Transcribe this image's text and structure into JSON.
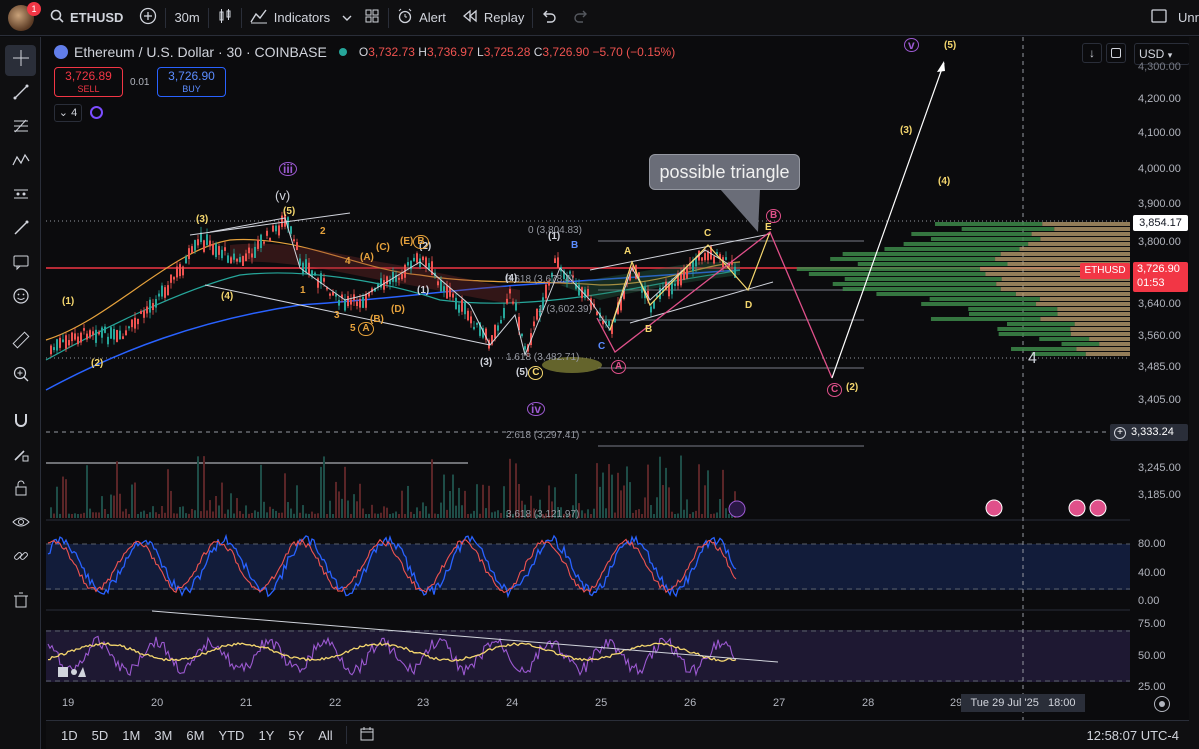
{
  "topbar": {
    "avatar_badge": "1",
    "symbol": "ETHUSD",
    "interval": "30m",
    "indicators": "Indicators",
    "alert": "Alert",
    "replay": "Replay",
    "right_text": "Unr"
  },
  "legend": {
    "title": "Ethereum / U.S. Dollar · 30 · COINBASE",
    "o_label": "O",
    "o": "3,732.73",
    "h_label": "H",
    "h": "3,736.97",
    "l_label": "L",
    "l": "3,725.28",
    "c_label": "C",
    "c": "3,726.90",
    "change": "−5.70 (−0.15%)",
    "sell_price": "3,726.89",
    "sell_label": "SELL",
    "spread": "0.01",
    "buy_price": "3,726.90",
    "buy_label": "BUY",
    "indicator_count": "4"
  },
  "currency": "USD",
  "price_axis": [
    "4,200.00",
    "4,100.00",
    "4,000.00",
    "3,900.00",
    "3,800.00",
    "3,640.00",
    "3,560.00",
    "3,485.00",
    "3,405.00",
    "3,245.00",
    "3,185.00"
  ],
  "price_axis_top_clip": "4,300.00",
  "price_badges": {
    "level": "3,854.17",
    "last_symbol": "ETHUSD",
    "last_price": "3,726.90",
    "countdown": "01:53",
    "crosshair": "3,333.24"
  },
  "osc_axis": [
    "80.00",
    "40.00",
    "0.00"
  ],
  "rsi_axis": [
    "75.00",
    "50.00",
    "25.00"
  ],
  "time_axis": [
    "19",
    "20",
    "21",
    "22",
    "23",
    "24",
    "25",
    "26",
    "27",
    "28",
    "29"
  ],
  "crosshair_time": "Tue 29 Jul '25   18:00",
  "fib_labels": {
    "f0": "0 (3,804.83)",
    "f0618": "0.618 (3,678.4)",
    "f1": "1 (3,602.39)",
    "f1618": "1.618 (3,482.71)",
    "f2618": "2.618 (3,297.41)",
    "f3618": "3.618 (3,121.97)"
  },
  "callout": "possible triangle",
  "waves": {
    "iii": "iii",
    "v_paren": "(v)",
    "iv": "iv",
    "v_big": "v",
    "w3": "(3)",
    "w5": "(5)",
    "w1": "(1)",
    "w2": "(2)",
    "w4": "(4)",
    "n1": "1",
    "n2": "2",
    "n3": "3",
    "n4": "4",
    "n5": "5",
    "A": "A",
    "B": "B",
    "C": "C",
    "D": "D",
    "E": "E",
    "pA": "(A)",
    "pB": "(B)",
    "pC": "(C)",
    "pD": "(D)",
    "pE": "(E)",
    "bigfour": "4"
  },
  "bottombar": {
    "ranges": [
      "1D",
      "5D",
      "1M",
      "3M",
      "6M",
      "YTD",
      "1Y",
      "5Y",
      "All"
    ],
    "clock": "12:58:07 UTC-4"
  },
  "colors": {
    "up": "#26a69a",
    "down": "#ef5350",
    "accent": "#2962ff",
    "wave_yellow": "#f5d76e",
    "wave_pink": "#e0508a",
    "wave_purple": "#9c59d1"
  }
}
